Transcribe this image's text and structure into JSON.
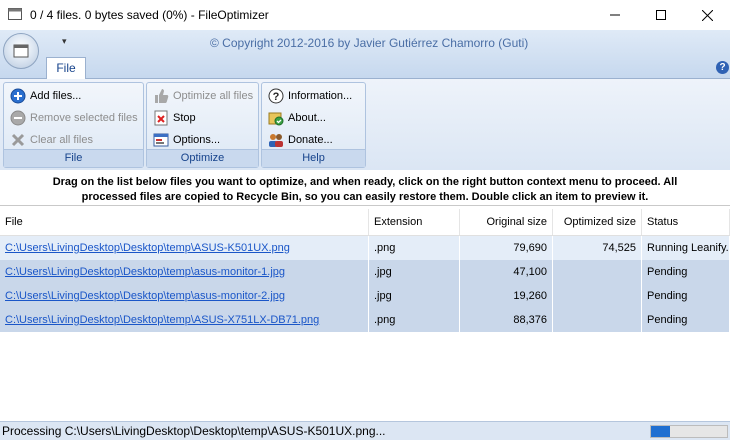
{
  "window": {
    "title": "0 / 4 files. 0 bytes saved (0%) - FileOptimizer"
  },
  "ribbon": {
    "copyright": "© Copyright 2012-2016 by Javier Gutiérrez Chamorro (Guti)",
    "tab_file": "File",
    "qat_glyph": "▾",
    "help_glyph": "?",
    "groups": {
      "file": {
        "label": "File",
        "add_files": "Add files...",
        "remove_selected": "Remove selected files",
        "clear_all": "Clear all files"
      },
      "optimize": {
        "label": "Optimize",
        "optimize_all": "Optimize all files",
        "stop": "Stop",
        "options": "Options..."
      },
      "help": {
        "label": "Help",
        "information": "Information...",
        "about": "About...",
        "donate": "Donate..."
      }
    }
  },
  "hint": {
    "line1": "Drag on the list below files you want to optimize, and when ready, click on the right button context menu to proceed. All",
    "line2": "processed files are copied to Recycle Bin, so you can easily restore them. Double click an item to preview it."
  },
  "list": {
    "columns": [
      "File",
      "Extension",
      "Original size",
      "Optimized size",
      "Status"
    ],
    "rows": [
      {
        "file": "C:\\Users\\LivingDesktop\\Desktop\\temp\\ASUS-K501UX.png",
        "ext": ".png",
        "orig": "79,690",
        "opt": "74,525",
        "status": "Running Leanify..."
      },
      {
        "file": "C:\\Users\\LivingDesktop\\Desktop\\temp\\asus-monitor-1.jpg",
        "ext": ".jpg",
        "orig": "47,100",
        "opt": "",
        "status": "Pending"
      },
      {
        "file": "C:\\Users\\LivingDesktop\\Desktop\\temp\\asus-monitor-2.jpg",
        "ext": ".jpg",
        "orig": "19,260",
        "opt": "",
        "status": "Pending"
      },
      {
        "file": "C:\\Users\\LivingDesktop\\Desktop\\temp\\ASUS-X751LX-DB71.png",
        "ext": ".png",
        "orig": "88,376",
        "opt": "",
        "status": "Pending"
      }
    ]
  },
  "statusbar": {
    "text": "Processing C:\\Users\\LivingDesktop\\Desktop\\temp\\ASUS-K501UX.png...",
    "progress_fraction": 0.25
  },
  "colors": {
    "accent": "#1f6fd1",
    "row_bg": "#c9d7ea",
    "link": "#1a56c8"
  }
}
